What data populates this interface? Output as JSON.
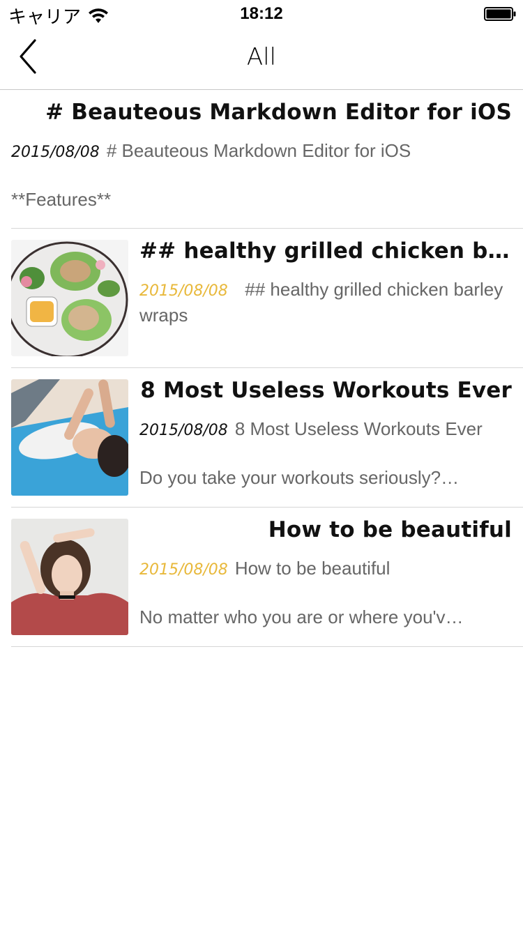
{
  "status": {
    "carrier": "キャリア",
    "time": "18:12"
  },
  "nav": {
    "title": "All"
  },
  "notes": [
    {
      "title": "# Beauteous Markdown Editor for iOS",
      "date": "2015/08/08",
      "summary": "# Beauteous Markdown Editor for iOS",
      "preview": "**Features**",
      "date_color": "black",
      "thumbnail": "none"
    },
    {
      "title": "## healthy grilled chicken barl…",
      "date": "2015/08/08",
      "summary": "## healthy grilled chicken barley wraps",
      "preview": "",
      "date_color": "gold",
      "thumbnail": "salad-photo"
    },
    {
      "title": "8 Most Useless Workouts Ever",
      "date": "2015/08/08",
      "summary": "8 Most Useless Workouts Ever",
      "preview": "Do you take your workouts seriously?…",
      "date_color": "black",
      "thumbnail": "workout-photo"
    },
    {
      "title": "How to be beautiful",
      "date": "2015/08/08",
      "summary": "How to be beautiful",
      "preview": "No matter who you are or where you'v…",
      "date_color": "gold",
      "thumbnail": "portrait-photo"
    }
  ],
  "colors": {
    "gold_date": "#e8b83a",
    "separator": "#d6d6d6"
  }
}
